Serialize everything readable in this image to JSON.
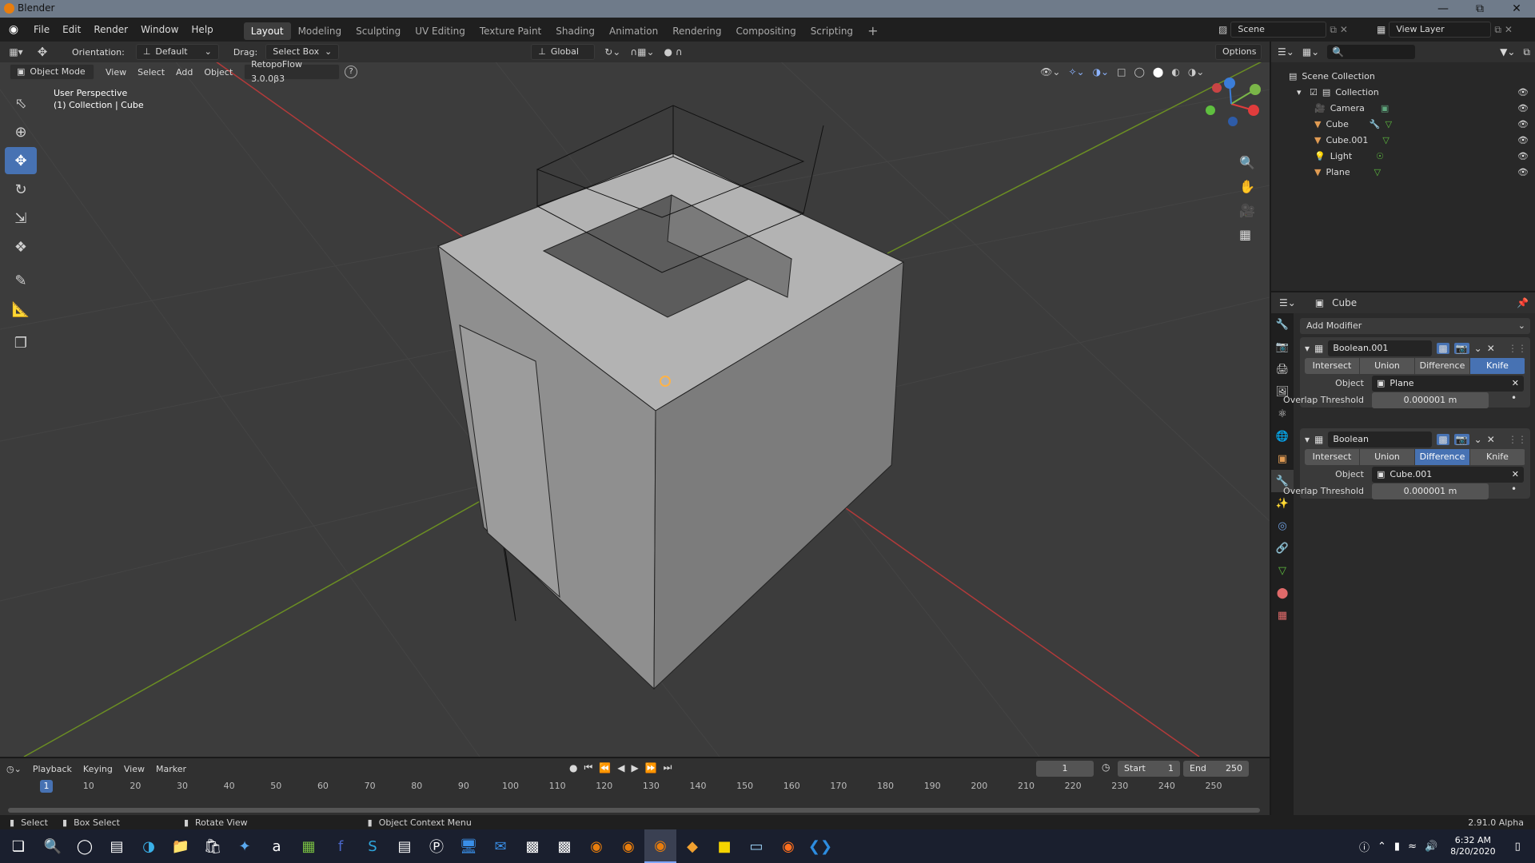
{
  "window": {
    "title": "Blender"
  },
  "menu": [
    "File",
    "Edit",
    "Render",
    "Window",
    "Help"
  ],
  "workspaces": [
    "Layout",
    "Modeling",
    "Sculpting",
    "UV Editing",
    "Texture Paint",
    "Shading",
    "Animation",
    "Rendering",
    "Compositing",
    "Scripting"
  ],
  "active_workspace": "Layout",
  "scene": {
    "scene_name": "Scene",
    "view_layer": "View Layer"
  },
  "header": {
    "orientation_label": "Orientation:",
    "orientation_value": "Default",
    "drag_label": "Drag:",
    "drag_value": "Select Box",
    "transform_orientation": "Global",
    "options": "Options"
  },
  "header2": {
    "mode": "Object Mode",
    "view": "View",
    "select": "Select",
    "add": "Add",
    "object": "Object",
    "addon": "RetopoFlow 3.0.0β3"
  },
  "viewport": {
    "perspective": "User Perspective",
    "collection_info": "(1) Collection | Cube",
    "accent": "#4772b3"
  },
  "outliner": {
    "root": "Scene Collection",
    "items": [
      {
        "label": "Collection"
      },
      {
        "label": "Camera"
      },
      {
        "label": "Cube"
      },
      {
        "label": "Cube.001"
      },
      {
        "label": "Light"
      },
      {
        "label": "Plane"
      }
    ]
  },
  "properties": {
    "object_name": "Cube",
    "add_modifier": "Add Modifier",
    "modifiers": [
      {
        "name": "Boolean.001",
        "ops": [
          "Intersect",
          "Union",
          "Difference",
          "Knife"
        ],
        "active_op": "Knife",
        "object_label": "Object",
        "object_value": "Plane",
        "threshold_label": "Overlap Threshold",
        "threshold_value": "0.000001 m"
      },
      {
        "name": "Boolean",
        "ops": [
          "Intersect",
          "Union",
          "Difference",
          "Knife"
        ],
        "active_op": "Difference",
        "object_label": "Object",
        "object_value": "Cube.001",
        "threshold_label": "Overlap Threshold",
        "threshold_value": "0.000001 m"
      }
    ]
  },
  "timeline": {
    "playback": "Playback",
    "keying": "Keying",
    "view": "View",
    "marker": "Marker",
    "current_frame": "1",
    "start_label": "Start",
    "start": "1",
    "end_label": "End",
    "end": "250",
    "ticks": [
      "1",
      "10",
      "20",
      "30",
      "40",
      "50",
      "60",
      "70",
      "80",
      "90",
      "100",
      "110",
      "120",
      "130",
      "140",
      "150",
      "160",
      "170",
      "180",
      "190",
      "200",
      "210",
      "220",
      "230",
      "240",
      "250"
    ]
  },
  "status": {
    "select": "Select",
    "box_select": "Box Select",
    "rotate_view": "Rotate View",
    "context_menu": "Object Context Menu",
    "version": "2.91.0 Alpha"
  },
  "taskbar": {
    "time": "6:32 AM",
    "date": "8/20/2020"
  }
}
